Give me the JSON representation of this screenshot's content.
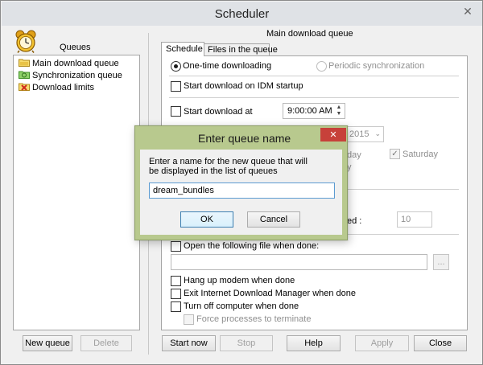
{
  "window": {
    "title": "Scheduler",
    "close_glyph": "✕"
  },
  "left_panel": {
    "title": "Queues",
    "queues": [
      {
        "label": "Main download queue",
        "icon": "folder-queue-icon"
      },
      {
        "label": "Synchronization queue",
        "icon": "sync-queue-icon"
      },
      {
        "label": "Download limits",
        "icon": "limits-icon"
      }
    ],
    "new_queue_button": "New queue",
    "delete_button": "Delete"
  },
  "right_panel": {
    "header": "Main download queue",
    "tabs": [
      "Schedule",
      "Files in the queue"
    ],
    "active_tab": "Schedule",
    "one_time_label": "One-time downloading",
    "periodic_label": "Periodic synchronization",
    "start_on_startup_label": "Start download on IDM startup",
    "start_at_label": "Start download at",
    "start_time": "9:00:00 AM",
    "date_partial": "2015",
    "day_partial_1": "day",
    "day_partial_2": "y",
    "saturday_label": "Saturday",
    "saturday_checked": true,
    "ed_partial": "ed :",
    "retry_value": "10",
    "open_file_label": "Open the following file when done:",
    "open_file_value": "",
    "browse_label": "...",
    "hang_up_label": "Hang up modem when done",
    "exit_idm_label": "Exit Internet Download Manager when done",
    "turn_off_label": "Turn off computer when done",
    "force_label": "Force processes to terminate"
  },
  "footer": {
    "start_now": "Start now",
    "stop": "Stop",
    "help": "Help",
    "apply": "Apply",
    "close": "Close"
  },
  "dialog": {
    "title": "Enter queue name",
    "close_glyph": "✕",
    "message": "Enter a name for the new queue that will be displayed in the list of queues",
    "input_value": "dream_bundles",
    "ok": "OK",
    "cancel": "Cancel"
  },
  "colors": {
    "dialog_title_bg": "#b8c98e",
    "dialog_close_bg": "#c7413a",
    "selected_border": "#3c7fb1"
  }
}
